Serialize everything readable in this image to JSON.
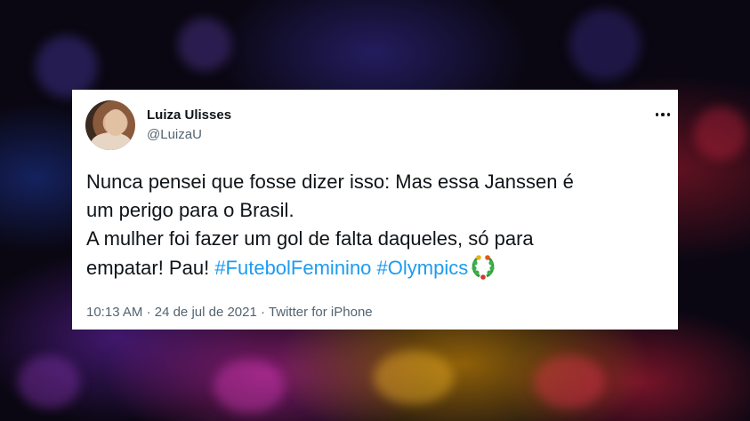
{
  "tweet": {
    "author_name": "Luiza Ulisses",
    "author_handle": "@LuizaU",
    "text_line1": "Nunca pensei que fosse dizer isso: Mas essa Janssen é",
    "text_line2": "um perigo para o Brasil.",
    "text_line3": "A mulher foi fazer um gol de falta daqueles, só para",
    "text_line4_prefix": "empatar! Pau!",
    "hashtags": [
      "#FutebolFeminino",
      "#Olympics"
    ],
    "time": "10:13 AM",
    "date": "24 de jul de 2021",
    "separator": "·",
    "source": "Twitter for iPhone",
    "icons": {
      "more": "more-options-icon",
      "hashtag_emoji": "olympic-laurel-icon"
    }
  },
  "colors": {
    "hashtag": "#1d9bf0",
    "text": "#0f1419",
    "muted": "#536471",
    "card": "#ffffff"
  }
}
